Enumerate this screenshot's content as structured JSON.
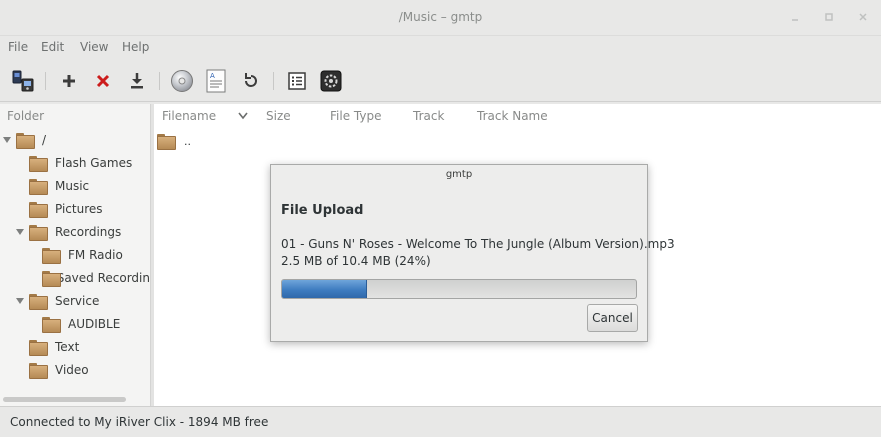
{
  "window": {
    "title": "/Music – gmtp",
    "controls": [
      "minimize-icon",
      "maximize-icon",
      "close-icon"
    ]
  },
  "menu": {
    "file": "File",
    "edit": "Edit",
    "view": "View",
    "help": "Help"
  },
  "toolbar": {
    "icons": [
      "device-properties-icon",
      "add-icon",
      "delete-icon",
      "download-icon",
      "disc-icon",
      "playlist-icon",
      "refresh-icon",
      "list-view-icon",
      "settings-icon"
    ],
    "colors": {
      "add": "#3c3c3c",
      "delete": "#cc1c1c"
    }
  },
  "sidebar": {
    "header": "Folder",
    "items": [
      {
        "label": "/",
        "level": 0,
        "expanded": true
      },
      {
        "label": "Flash Games",
        "level": 1
      },
      {
        "label": "Music",
        "level": 1
      },
      {
        "label": "Pictures",
        "level": 1
      },
      {
        "label": "Recordings",
        "level": 1,
        "expanded": true
      },
      {
        "label": "FM Radio",
        "level": 2
      },
      {
        "label": "Saved Recordin",
        "level": 2
      },
      {
        "label": "Service",
        "level": 1,
        "expanded": true
      },
      {
        "label": "AUDIBLE",
        "level": 2
      },
      {
        "label": "Text",
        "level": 1
      },
      {
        "label": "Video",
        "level": 1
      }
    ]
  },
  "filelist": {
    "columns": [
      "Filename",
      "Size",
      "File Type",
      "Track",
      "Track Name"
    ],
    "rows": [
      {
        "name": ".."
      }
    ]
  },
  "status": {
    "text": "Connected to My iRiver Clix - 1894 MB free"
  },
  "dialog": {
    "title": "gmtp",
    "heading": "File Upload",
    "filename": "01 - Guns N' Roses - Welcome To The Jungle (Album Version).mp3",
    "size_text": "2.5 MB of 10.4 MB (24%)",
    "progress": 0.24,
    "cancel_label": "Cancel",
    "accent": "#3e7cc0"
  }
}
